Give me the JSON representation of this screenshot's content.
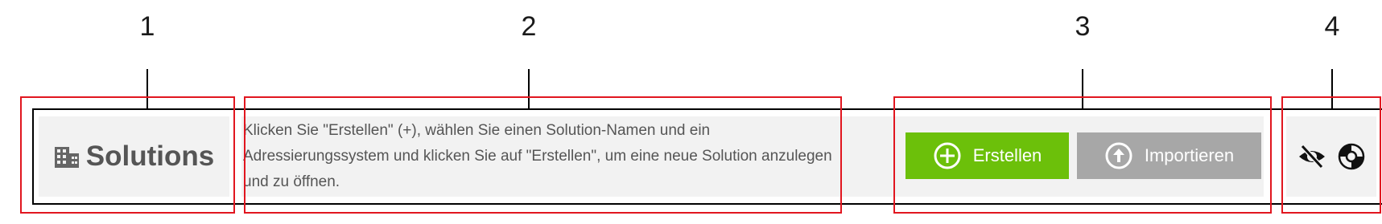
{
  "callouts": [
    "1",
    "2",
    "3",
    "4"
  ],
  "header": {
    "title": "Solutions",
    "title_icon": "building-icon"
  },
  "help": {
    "text": "Klicken Sie \"Erstellen\" (+), wählen Sie einen Solution-Namen und ein Adressierungssystem und klicken Sie auf \"Erstellen\", um eine neue Solution anzulegen und zu öffnen."
  },
  "actions": {
    "create_label": "Erstellen",
    "create_icon": "plus-circle-icon",
    "import_label": "Importieren",
    "import_icon": "upload-circle-icon"
  },
  "tools": {
    "hide_icon": "eye-slash-icon",
    "help_icon": "lifebuoy-icon"
  },
  "colors": {
    "create_button": "#6cc00a",
    "import_button": "#a7a7a7",
    "callout_box": "#e1161f",
    "panel_bg": "#f2f2f2",
    "text": "#555555"
  }
}
